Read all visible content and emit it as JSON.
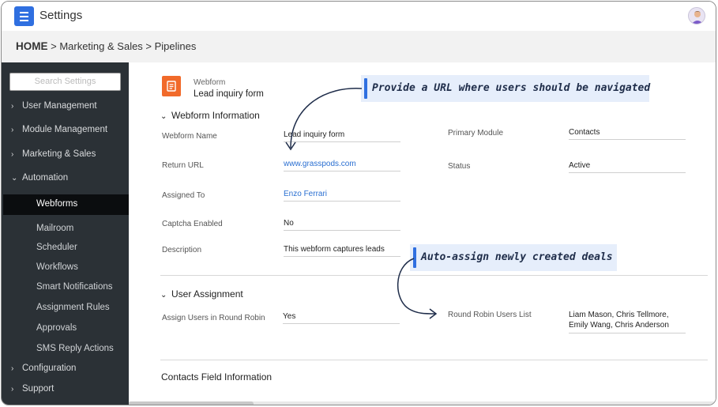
{
  "app": {
    "title": "Settings"
  },
  "breadcrumb": {
    "home": "HOME",
    "path": " > Marketing & Sales > Pipelines"
  },
  "sidebar": {
    "search_placeholder": "Search Settings",
    "items": [
      {
        "label": "User Management",
        "expanded": false
      },
      {
        "label": "Module Management",
        "expanded": false
      },
      {
        "label": "Marketing & Sales",
        "expanded": false
      },
      {
        "label": "Automation",
        "expanded": true
      },
      {
        "label": "Configuration",
        "expanded": false
      },
      {
        "label": "Support",
        "expanded": false
      }
    ],
    "automation_children": [
      "Webforms",
      "Mailroom",
      "Scheduler",
      "Workflows",
      "Smart Notifications",
      "Assignment Rules",
      "Approvals",
      "SMS Reply Actions"
    ],
    "active_child": "Webforms"
  },
  "form": {
    "kind": "Webform",
    "name": "Lead inquiry form",
    "sections": {
      "info": "Webform Information",
      "assignment": "User Assignment",
      "contacts": "Contacts Field Information"
    },
    "fields": {
      "webform_name": {
        "label": "Webform Name",
        "value": "Lead inquiry form"
      },
      "return_url": {
        "label": "Return URL",
        "value": "www.grasspods.com"
      },
      "assigned_to": {
        "label": "Assigned To",
        "value": "Enzo Ferrari"
      },
      "captcha": {
        "label": "Captcha Enabled",
        "value": "No"
      },
      "description": {
        "label": "Description",
        "value": "This webform captures leads"
      },
      "primary_module": {
        "label": "Primary Module",
        "value": "Contacts"
      },
      "status": {
        "label": "Status",
        "value": "Active"
      },
      "round_robin": {
        "label": "Assign Users in Round Robin",
        "value": "Yes"
      },
      "round_robin_users": {
        "label": "Round Robin Users List",
        "value": "Liam Mason, Chris Tellmore, Emily Wang, Chris Anderson"
      }
    }
  },
  "callouts": {
    "url": "Provide a URL where users should be navigated",
    "assign": "Auto-assign newly created deals"
  },
  "colors": {
    "accent": "#2f6fe0",
    "sidebar": "#2b3136",
    "form_icon": "#f16a2a",
    "callout_bg": "#e6eefb"
  },
  "icons": {
    "menu": "hamburger-icon",
    "avatar": "user-avatar",
    "form": "document-icon"
  }
}
